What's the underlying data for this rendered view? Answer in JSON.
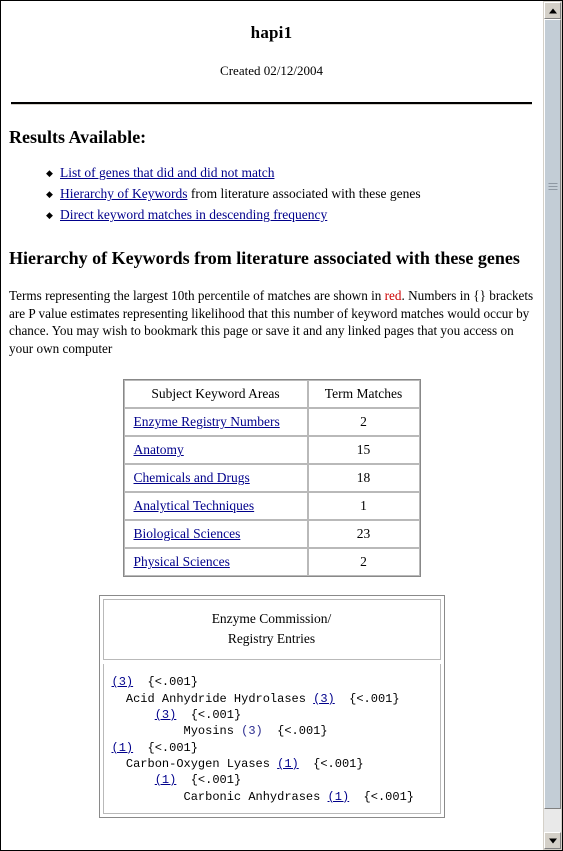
{
  "page": {
    "title": "hapi1",
    "created": "Created 02/12/2004"
  },
  "results_section": {
    "heading": "Results Available:",
    "items": [
      {
        "link": "List of genes that did and did not match",
        "tail": ""
      },
      {
        "link": "Hierarchy of Keywords",
        "tail": " from literature associated with these genes"
      },
      {
        "link": "Direct keyword matches in descending frequency",
        "tail": ""
      }
    ]
  },
  "hierarchy_section": {
    "heading": "Hierarchy of Keywords from literature associated with these genes",
    "intro_part1": "Terms representing the largest 10th percentile of matches are shown in ",
    "intro_red": "red",
    "intro_part2": ". Numbers in {} brackets are P value estimates representing likelihood that this number of keyword matches would occur by chance. You may wish to bookmark this page or save it and any linked pages that you access on your own computer"
  },
  "keyword_table": {
    "headers": [
      "Subject Keyword Areas",
      "Term Matches"
    ],
    "rows": [
      {
        "area": "Enzyme Registry Numbers",
        "matches": "2"
      },
      {
        "area": "Anatomy",
        "matches": "15"
      },
      {
        "area": "Chemicals and Drugs",
        "matches": "18"
      },
      {
        "area": "Analytical Techniques",
        "matches": "1"
      },
      {
        "area": "Biological Sciences",
        "matches": "23"
      },
      {
        "area": "Physical Sciences",
        "matches": "2"
      }
    ]
  },
  "enzyme_box": {
    "header_line1": "Enzyme Commission/",
    "header_line2": "Registry Entries",
    "lines": [
      {
        "indent": 0,
        "count": "(3)",
        "linked": true,
        "label": "",
        "p": "{<.001}"
      },
      {
        "indent": 2,
        "count": "(3)",
        "linked": true,
        "label": "Acid Anhydride Hydrolases",
        "p": "{<.001}"
      },
      {
        "indent": 6,
        "count": "(3)",
        "linked": true,
        "label": "",
        "p": "{<.001}"
      },
      {
        "indent": 10,
        "count": "(3)",
        "linked": false,
        "label": "Myosins",
        "p": "{<.001}"
      },
      {
        "indent": 0,
        "count": "(1)",
        "linked": true,
        "label": "",
        "p": "{<.001}"
      },
      {
        "indent": 2,
        "count": "(1)",
        "linked": true,
        "label": "Carbon-Oxygen Lyases",
        "p": "{<.001}"
      },
      {
        "indent": 6,
        "count": "(1)",
        "linked": true,
        "label": "",
        "p": "{<.001}"
      },
      {
        "indent": 10,
        "count": "(1)",
        "linked": true,
        "label": "Carbonic Anhydrases",
        "p": "{<.001}"
      }
    ]
  },
  "colors": {
    "link": "#00008b",
    "red_highlight": "#cc0000",
    "scrollbar_face": "#d4d0c8",
    "scrollbar_thumb": "#c3cdd6"
  }
}
